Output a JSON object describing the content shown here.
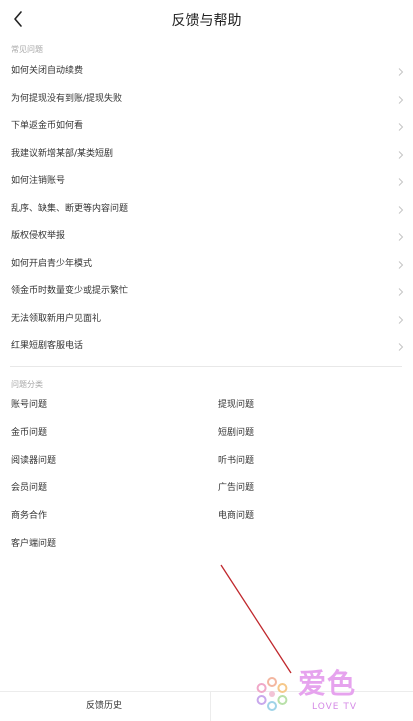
{
  "header": {
    "title": "反馈与帮助"
  },
  "faq": {
    "section_title": "常见问题",
    "items": [
      "如何关闭自动续费",
      "为何提现没有到账/提现失败",
      "下单返金币如何看",
      "我建议新增某部/某类短剧",
      "如何注销账号",
      "乱序、缺集、断更等内容问题",
      "版权侵权举报",
      "如何开启青少年模式",
      "领金币时数量变少或提示繁忙",
      "无法领取新用户见面礼",
      "红果短剧客服电话"
    ]
  },
  "categories": {
    "section_title": "问题分类",
    "items": [
      "账号问题",
      "提现问题",
      "金币问题",
      "短剧问题",
      "阅读器问题",
      "听书问题",
      "会员问题",
      "广告问题",
      "商务合作",
      "电商问题",
      "客户端问题"
    ]
  },
  "bottom": {
    "history_label": "反馈历史"
  },
  "watermark": {
    "cn": "爱色",
    "en": "LOVE TV"
  },
  "colors": {
    "annotation": "#c0282d",
    "text": "#333333",
    "muted": "#a8a8a8"
  }
}
